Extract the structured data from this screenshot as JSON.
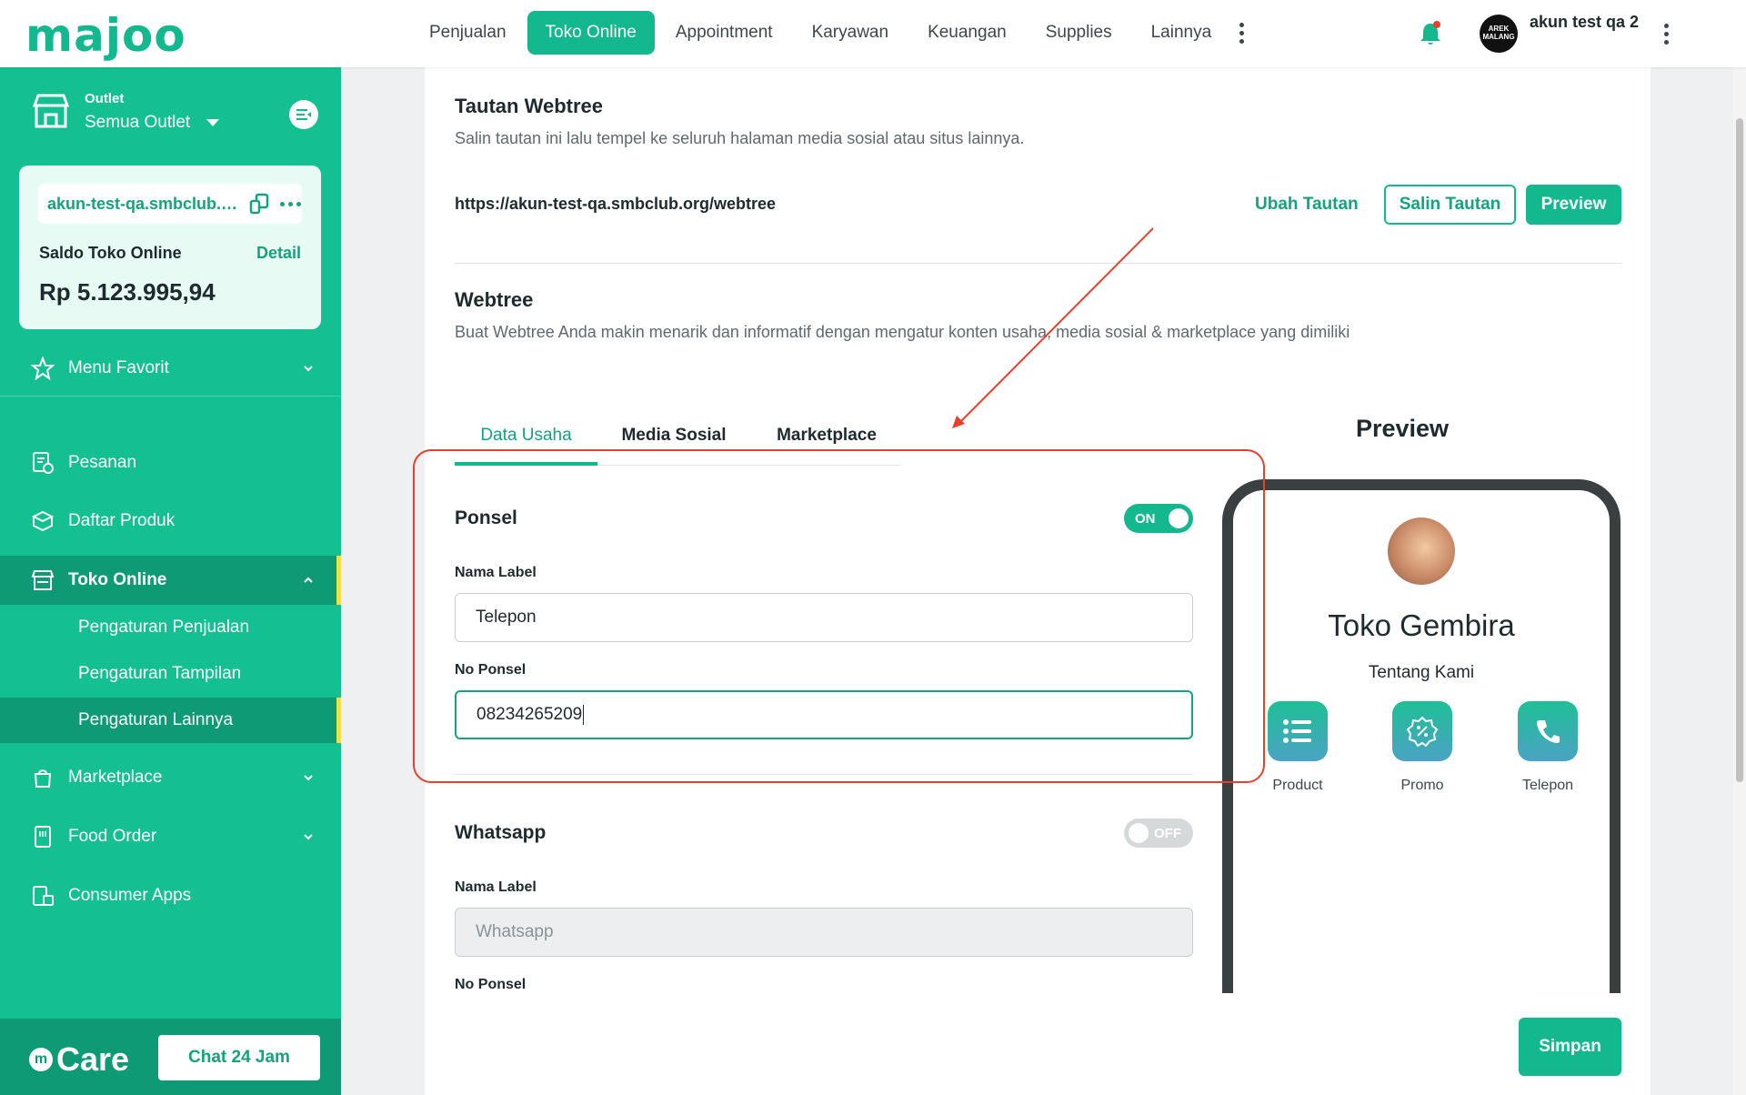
{
  "brand": {
    "logo": "majoo",
    "accent": "#14b88e",
    "sidebar_bg": "#14bf92",
    "sidebar_active": "#0f9a76",
    "highlight": "#f3df4a",
    "annotation": "#e8402f"
  },
  "topnav": {
    "items": [
      {
        "label": "Penjualan",
        "active": false
      },
      {
        "label": "Toko Online",
        "active": true
      },
      {
        "label": "Appointment",
        "active": false
      },
      {
        "label": "Karyawan",
        "active": false
      },
      {
        "label": "Keuangan",
        "active": false
      },
      {
        "label": "Supplies",
        "active": false
      },
      {
        "label": "Lainnya",
        "active": false
      }
    ],
    "avatar_text": "AREK MALANG",
    "user_name": "akun test qa 2"
  },
  "sidebar": {
    "outlet_label": "Outlet",
    "outlet_value": "Semua Outlet",
    "store_url": "akun-test-qa.smbclub.org",
    "saldo_title": "Saldo Toko Online",
    "saldo_detail": "Detail",
    "saldo_amount": "Rp 5.123.995,94",
    "menu_favorit": "Menu Favorit",
    "items": [
      {
        "label": "Pesanan"
      },
      {
        "label": "Daftar Produk"
      },
      {
        "label": "Toko Online"
      },
      {
        "label": "Marketplace"
      },
      {
        "label": "Food Order"
      },
      {
        "label": "Consumer Apps"
      }
    ],
    "subitems": [
      {
        "label": "Pengaturan Penjualan"
      },
      {
        "label": "Pengaturan Tampilan"
      },
      {
        "label": "Pengaturan Lainnya"
      }
    ],
    "care_logo": "Care",
    "chat_button": "Chat 24 Jam"
  },
  "main": {
    "tautan": {
      "title": "Tautan Webtree",
      "desc": "Salin tautan ini lalu tempel ke seluruh halaman media sosial atau situs lainnya.",
      "url": "https://akun-test-qa.smbclub.org/webtree",
      "ubah": "Ubah Tautan",
      "salin": "Salin Tautan",
      "preview": "Preview"
    },
    "webtree": {
      "title": "Webtree",
      "desc": "Buat Webtree Anda makin menarik dan informatif dengan mengatur konten usaha, media sosial & marketplace yang dimiliki"
    },
    "tabs": [
      {
        "label": "Data Usaha",
        "active": true
      },
      {
        "label": "Media Sosial",
        "active": false
      },
      {
        "label": "Marketplace",
        "active": false
      }
    ],
    "ponsel": {
      "title": "Ponsel",
      "toggle": "ON",
      "nama_label": "Nama Label",
      "nama_value": "Telepon",
      "no_label": "No Ponsel",
      "no_value": "08234265209"
    },
    "whatsapp": {
      "title": "Whatsapp",
      "toggle": "OFF",
      "nama_label": "Nama Label",
      "nama_placeholder": "Whatsapp",
      "no_label": "No Ponsel"
    },
    "preview": {
      "title": "Preview",
      "store_name": "Toko Gembira",
      "about": "Tentang Kami",
      "apps": [
        {
          "label": "Product"
        },
        {
          "label": "Promo"
        },
        {
          "label": "Telepon"
        }
      ]
    },
    "simpan": "Simpan"
  }
}
